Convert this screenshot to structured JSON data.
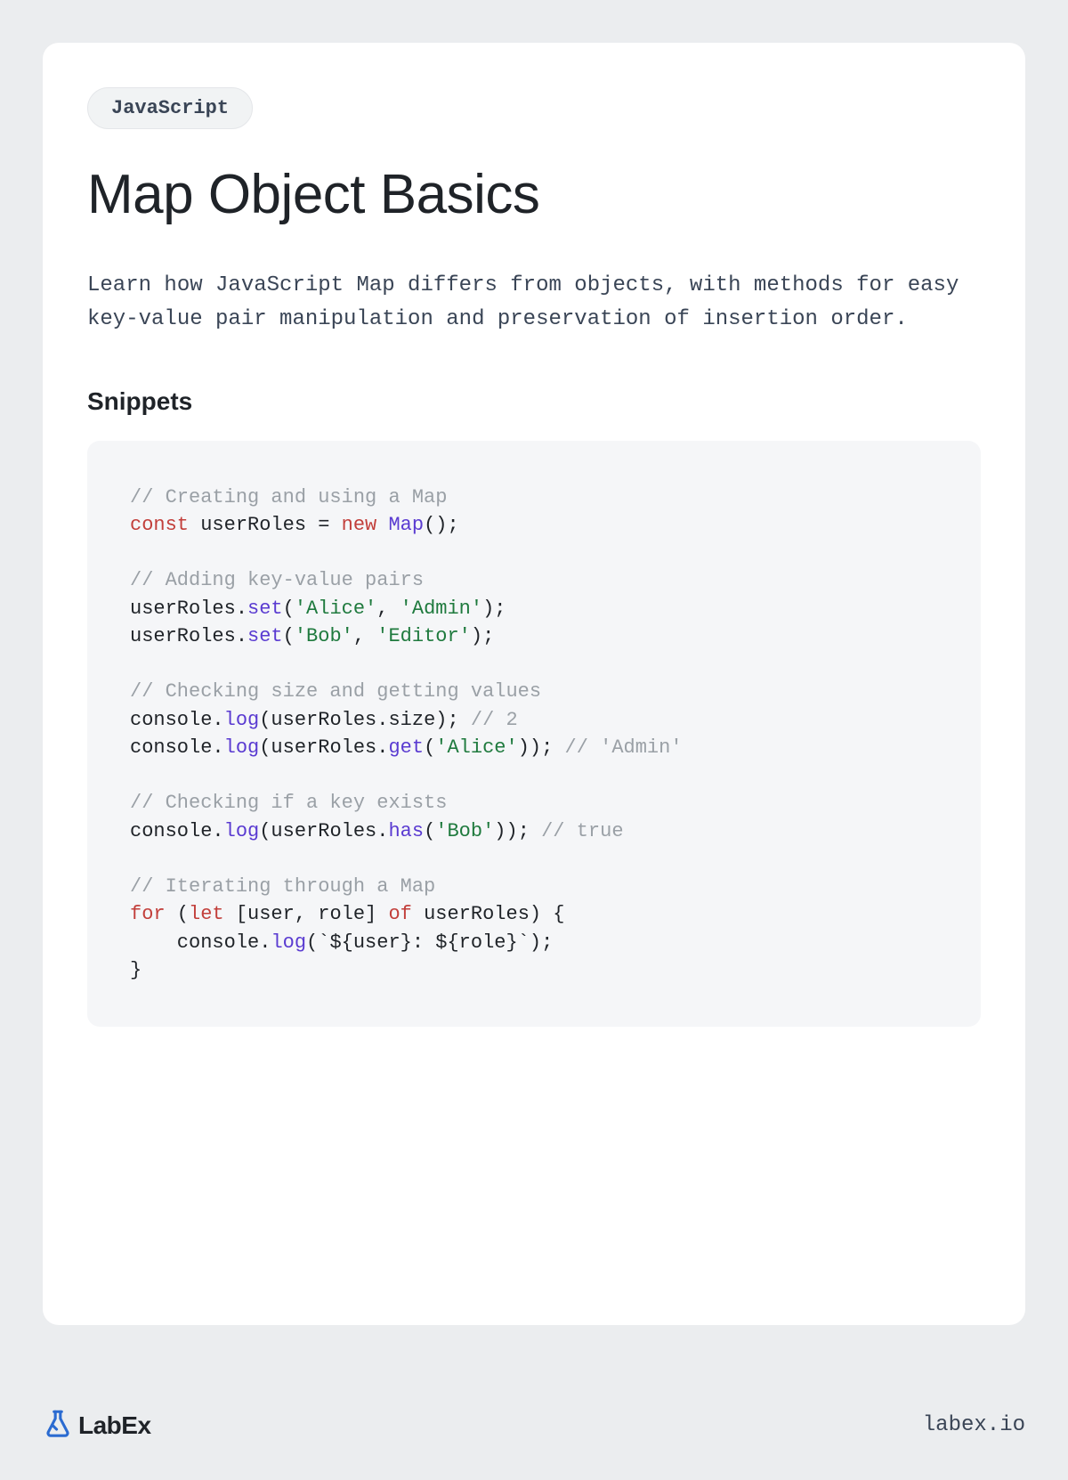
{
  "badge": "JavaScript",
  "title": "Map Object Basics",
  "description": "Learn how JavaScript Map differs from objects, with methods for easy key-value pair manipulation and preservation of insertion order.",
  "section_title": "Snippets",
  "code_tokens": [
    {
      "t": "// Creating and using a Map",
      "c": "comment"
    },
    {
      "t": "\n"
    },
    {
      "t": "const",
      "c": "keyword"
    },
    {
      "t": " userRoles = ",
      "c": "ident"
    },
    {
      "t": "new",
      "c": "keyword"
    },
    {
      "t": " ",
      "c": "ident"
    },
    {
      "t": "Map",
      "c": "class"
    },
    {
      "t": "();",
      "c": "punct"
    },
    {
      "t": "\n"
    },
    {
      "t": "\n"
    },
    {
      "t": "// Adding key-value pairs",
      "c": "comment"
    },
    {
      "t": "\n"
    },
    {
      "t": "userRoles.",
      "c": "ident"
    },
    {
      "t": "set",
      "c": "method"
    },
    {
      "t": "(",
      "c": "punct"
    },
    {
      "t": "'Alice'",
      "c": "string"
    },
    {
      "t": ", ",
      "c": "punct"
    },
    {
      "t": "'Admin'",
      "c": "string"
    },
    {
      "t": ");",
      "c": "punct"
    },
    {
      "t": "\n"
    },
    {
      "t": "userRoles.",
      "c": "ident"
    },
    {
      "t": "set",
      "c": "method"
    },
    {
      "t": "(",
      "c": "punct"
    },
    {
      "t": "'Bob'",
      "c": "string"
    },
    {
      "t": ", ",
      "c": "punct"
    },
    {
      "t": "'Editor'",
      "c": "string"
    },
    {
      "t": ");",
      "c": "punct"
    },
    {
      "t": "\n"
    },
    {
      "t": "\n"
    },
    {
      "t": "// Checking size and getting values",
      "c": "comment"
    },
    {
      "t": "\n"
    },
    {
      "t": "console",
      "c": "ident"
    },
    {
      "t": ".",
      "c": "punct"
    },
    {
      "t": "log",
      "c": "method"
    },
    {
      "t": "(userRoles.size); ",
      "c": "ident"
    },
    {
      "t": "// 2",
      "c": "comment"
    },
    {
      "t": "\n"
    },
    {
      "t": "console",
      "c": "ident"
    },
    {
      "t": ".",
      "c": "punct"
    },
    {
      "t": "log",
      "c": "method"
    },
    {
      "t": "(userRoles.",
      "c": "ident"
    },
    {
      "t": "get",
      "c": "method"
    },
    {
      "t": "(",
      "c": "punct"
    },
    {
      "t": "'Alice'",
      "c": "string"
    },
    {
      "t": ")); ",
      "c": "punct"
    },
    {
      "t": "// 'Admin'",
      "c": "comment"
    },
    {
      "t": "\n"
    },
    {
      "t": "\n"
    },
    {
      "t": "// Checking if a key exists",
      "c": "comment"
    },
    {
      "t": "\n"
    },
    {
      "t": "console",
      "c": "ident"
    },
    {
      "t": ".",
      "c": "punct"
    },
    {
      "t": "log",
      "c": "method"
    },
    {
      "t": "(userRoles.",
      "c": "ident"
    },
    {
      "t": "has",
      "c": "method"
    },
    {
      "t": "(",
      "c": "punct"
    },
    {
      "t": "'Bob'",
      "c": "string"
    },
    {
      "t": ")); ",
      "c": "punct"
    },
    {
      "t": "// true",
      "c": "comment"
    },
    {
      "t": "\n"
    },
    {
      "t": "\n"
    },
    {
      "t": "// Iterating through a Map",
      "c": "comment"
    },
    {
      "t": "\n"
    },
    {
      "t": "for",
      "c": "keyword"
    },
    {
      "t": " (",
      "c": "punct"
    },
    {
      "t": "let",
      "c": "keyword"
    },
    {
      "t": " [user, role] ",
      "c": "ident"
    },
    {
      "t": "of",
      "c": "keyword"
    },
    {
      "t": " userRoles) {",
      "c": "ident"
    },
    {
      "t": "\n"
    },
    {
      "t": "    console",
      "c": "ident"
    },
    {
      "t": ".",
      "c": "punct"
    },
    {
      "t": "log",
      "c": "method"
    },
    {
      "t": "(`${user}: ${role}`);",
      "c": "ident"
    },
    {
      "t": "\n"
    },
    {
      "t": "}",
      "c": "punct"
    }
  ],
  "footer": {
    "logo_text": "LabEx",
    "site": "labex.io"
  }
}
